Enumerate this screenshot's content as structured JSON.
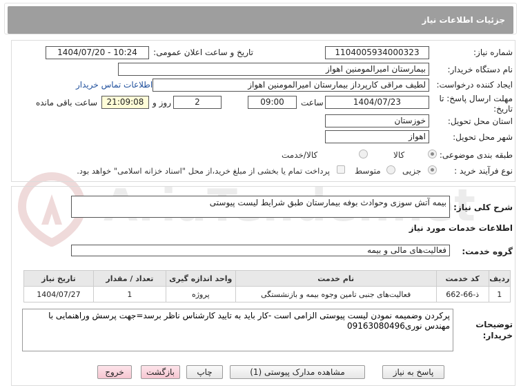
{
  "header": {
    "title": "جزئیات اطلاعات نیاز"
  },
  "form": {
    "need_number_label": "شماره نیاز:",
    "need_number": "1104005934000323",
    "announce_label": "تاریخ و ساعت اعلان عمومی:",
    "announce_value": "1404/07/20 - 10:24",
    "buyer_org_label": "نام دستگاه خریدار:",
    "buyer_org": "بیمارستان امیرالمومنین اهواز",
    "creator_label": "ایجاد کننده درخواست:",
    "creator": "لطیف مراقی کارپرداز بیمارستان امیرالمومنین اهواز",
    "contact_link": "اطلاعات تماس خریدار",
    "deadline_label_1": "مهلت ارسال پاسخ: تا",
    "deadline_label_2": "تاریخ:",
    "deadline_date": "1404/07/23",
    "time_label": "ساعت",
    "deadline_time": "09:00",
    "days_value": "2",
    "days_label": "روز و",
    "remaining_time": "21:09:08",
    "remaining_label": "ساعت باقی مانده",
    "province_label": "استان محل تحویل:",
    "province": "خوزستان",
    "city_label": "شهر محل تحویل:",
    "city": "اهواز",
    "category_label": "طبقه بندی موضوعی:",
    "category_options": [
      "کالا",
      "کالا/خدمت"
    ],
    "process_label": "نوع فرآیند خرید :",
    "process_options": [
      "جزیی",
      "متوسط"
    ],
    "payment_note": "پرداخت تمام یا بخشی از مبلغ خرید،از محل \"اسناد خزانه اسلامی\" خواهد بود."
  },
  "summary": {
    "label": "شرح کلی نیاز:",
    "text": "بیمه آتش سوزی وحوادث بوفه بیمارستان طبق شرایط لیست پیوستی"
  },
  "services": {
    "heading": "اطلاعات خدمات مورد نیاز",
    "group_label": "گروه خدمت:",
    "group_value": "فعالیت‌های مالی و بیمه",
    "columns": [
      "ردیف",
      "کد خدمت",
      "نام خدمت",
      "واحد اندازه گیری",
      "تعداد / مقدار",
      "تاریخ نیاز"
    ],
    "rows": [
      [
        "1",
        "ذ-66-662",
        "فعالیت‌های جنبی تامین وجوه بیمه و بازنشستگی",
        "پروژه",
        "1",
        "1404/07/27"
      ]
    ]
  },
  "buyer_notes": {
    "label_1": "توضیحات",
    "label_2": "خریدار:",
    "text": "پرکردن وضمیمه نمودن لیست پیوستی الزامی است -کار باید به تایید کارشناس ناظر برسد=جهت پرسش وراهنمایی با مهندس نوری09163080496"
  },
  "buttons": {
    "reply": "پاسخ به نیاز",
    "attachments": "مشاهده مدارک پیوستی (1)",
    "print": "چاپ",
    "back": "بازگشت",
    "exit": "خروج"
  },
  "watermark": {
    "text": "AriaTender.net"
  }
}
